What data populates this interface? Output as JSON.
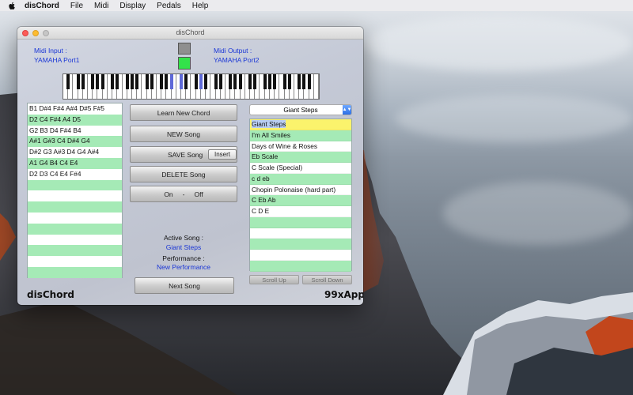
{
  "menubar": {
    "app_name": "disChord",
    "items": [
      "File",
      "Midi",
      "Display",
      "Pedals",
      "Help"
    ]
  },
  "window": {
    "title": "disChord",
    "midi_input_label": "Midi Input :",
    "midi_input_value": "YAMAHA Port1",
    "midi_output_label": "Midi Output :",
    "midi_output_value": "YAMAHA Port2",
    "indicator_colors": {
      "top": "#8f8f8f",
      "bottom": "#33e24a"
    },
    "brand_left": "disChord",
    "brand_right": "99xApp"
  },
  "chords": [
    "B1 D#4 F#4 A#4 D#5 F#5",
    "D2 C4 F#4 A4 D5",
    "G2 B3 D4 F#4 B4",
    "A#1 G#3 C4 D#4 G4",
    "D#2 G3 A#3 D4 G4 A#4",
    "A1 G4 B4 C4 E4",
    "D2 D3 C4 E4 F#4",
    "",
    "",
    "",
    "",
    "",
    "",
    "",
    "",
    ""
  ],
  "buttons": {
    "learn": "Learn New Chord",
    "new_song": "NEW Song",
    "save_song": "SAVE Song",
    "insert": "Insert",
    "delete_song": "DELETE Song",
    "on": "On",
    "dash": "-",
    "off": "Off",
    "next_song": "Next Song",
    "scroll_up": "Scroll Up",
    "scroll_down": "Scroll Down"
  },
  "status": {
    "active_song_label": "Active Song :",
    "active_song_value": "Giant Steps",
    "performance_label": "Performance :",
    "performance_value": "New Performance"
  },
  "song_select": {
    "selected": "Giant Steps"
  },
  "songs": [
    "Giant Steps",
    "I'm All Smiles",
    "Days of Wine & Roses",
    "Eb Scale",
    "C Scale (Special)",
    "c d eb",
    "Chopin Polonaise (hard part)",
    "C Eb  Ab",
    "C D E",
    "",
    "",
    "",
    "",
    ""
  ],
  "piano": {
    "white_keys": 52,
    "highlighted_black_keys": [
      15,
      16,
      19
    ]
  }
}
